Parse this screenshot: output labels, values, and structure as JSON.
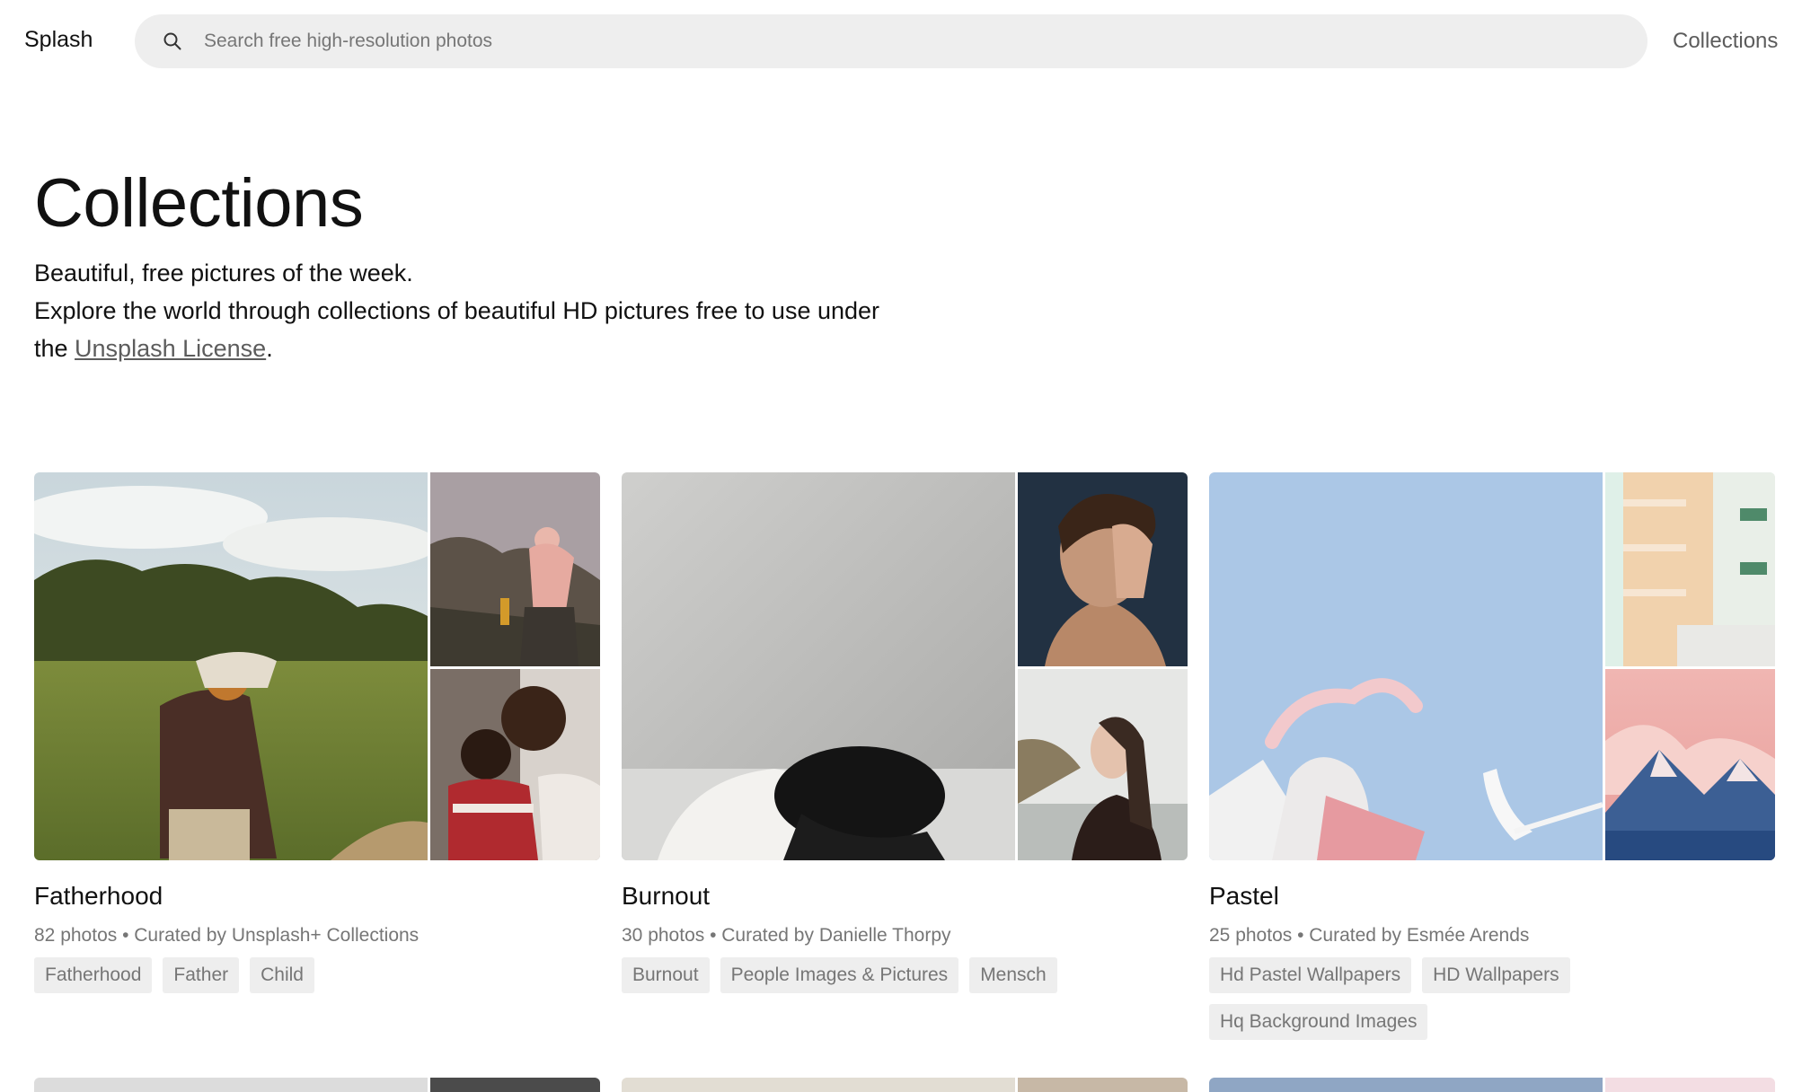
{
  "header": {
    "brand": "Splash",
    "search_placeholder": "Search free high-resolution photos",
    "nav_collections": "Collections"
  },
  "hero": {
    "title": "Collections",
    "line1": "Beautiful, free pictures of the week.",
    "line2_prefix": "Explore the world through collections of beautiful HD pictures free to use under the ",
    "license_link": "Unsplash License",
    "line2_suffix": "."
  },
  "collections": [
    {
      "title": "Fatherhood",
      "meta": "82 photos • Curated by Unsplash+ Collections",
      "tags": [
        "Fatherhood",
        "Father",
        "Child"
      ]
    },
    {
      "title": "Burnout",
      "meta": "30 photos • Curated by Danielle Thorpy",
      "tags": [
        "Burnout",
        "People Images & Pictures",
        "Mensch"
      ]
    },
    {
      "title": "Pastel",
      "meta": "25 photos • Curated by Esmée Arends",
      "tags": [
        "Hd Pastel Wallpapers",
        "HD Wallpapers",
        "Hq Background Images"
      ]
    }
  ],
  "colors": {
    "text": "#111111",
    "muted": "#767676",
    "chip_bg": "#eeeeee",
    "search_bg": "#eeeeee",
    "link": "#5c5c5c"
  },
  "icons": {
    "search": "search-icon"
  }
}
